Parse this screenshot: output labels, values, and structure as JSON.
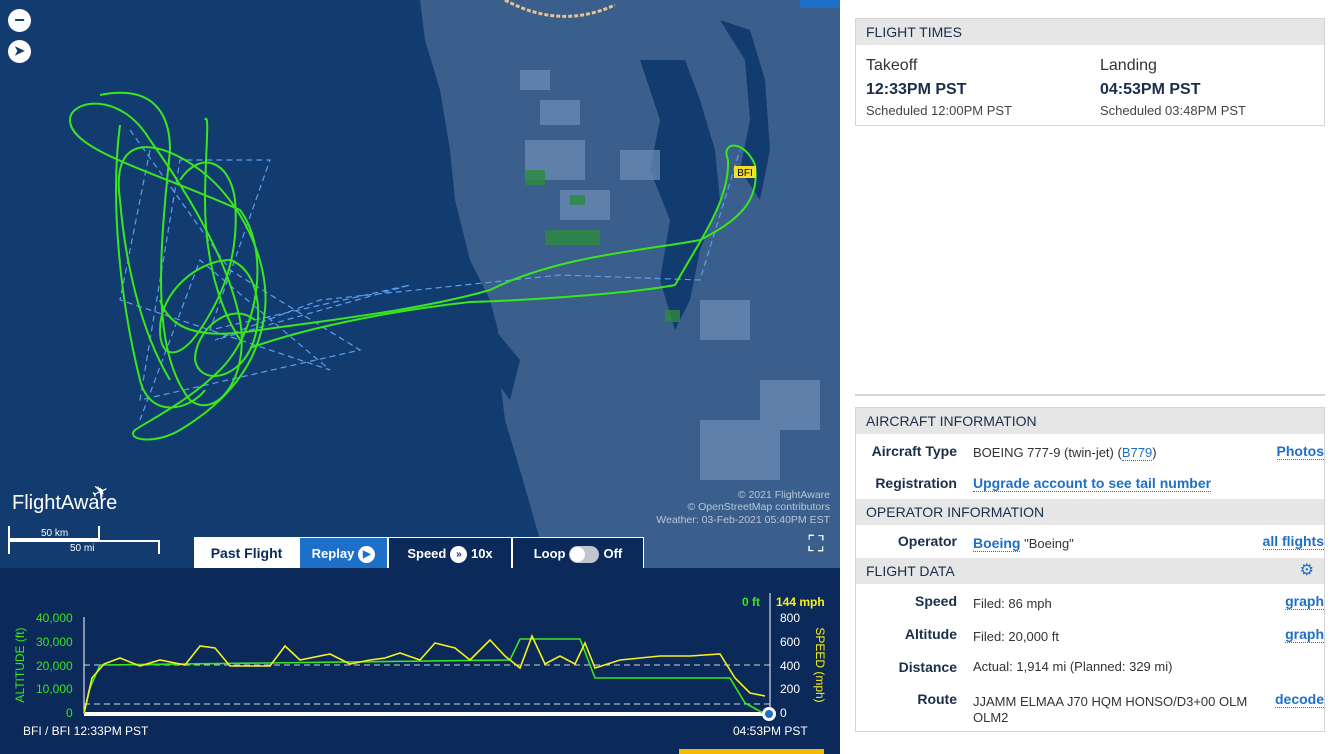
{
  "map": {
    "airport_code": "BFI",
    "logo": "FlightAware",
    "scale": {
      "km": "50 km",
      "mi": "50 mi"
    },
    "attribution": [
      "© 2021 FlightAware",
      "© OpenStreetMap contributors",
      "Weather: 03-Feb-2021 05:40PM EST"
    ],
    "zoom_out_icon": "minus-icon",
    "compass_icon": "compass-icon",
    "expand_icon": "expand-icon",
    "colors": {
      "track": "#39e61e",
      "planned": "#5a9eef",
      "land": "#3a5f8c",
      "water": "#123c70"
    }
  },
  "playback": {
    "past_flight": "Past Flight",
    "replay": "Replay",
    "speed_label": "Speed",
    "speed_value": "10x",
    "loop_label": "Loop",
    "loop_value": "Off"
  },
  "graph": {
    "current_altitude": "0 ft",
    "current_speed": "144 mph",
    "altitude_label": "ALTITUDE (ft)",
    "speed_label": "SPEED (mph)",
    "altitude_ticks": [
      "40,000",
      "30,000",
      "20,000",
      "10,000",
      "0"
    ],
    "speed_ticks": [
      "800",
      "600",
      "400",
      "200",
      "0"
    ],
    "start_label": "BFI / BFI 12:33PM PST",
    "end_label": "04:53PM PST",
    "colors": {
      "altitude": "#39e61e",
      "speed": "#f5f01e"
    }
  },
  "flight_times": {
    "header": "FLIGHT TIMES",
    "takeoff": {
      "label": "Takeoff",
      "time": "12:33PM PST",
      "scheduled": "Scheduled 12:00PM PST"
    },
    "landing": {
      "label": "Landing",
      "time": "04:53PM PST",
      "scheduled": "Scheduled 03:48PM PST"
    }
  },
  "aircraft": {
    "header": "AIRCRAFT INFORMATION",
    "type_label": "Aircraft Type",
    "type_value": "BOEING 777-9 (twin-jet) (",
    "type_code": "B779",
    "type_close": ")",
    "photos": "Photos",
    "registration_label": "Registration",
    "registration_value": "Upgrade account to see tail number"
  },
  "operator": {
    "header": "OPERATOR INFORMATION",
    "label": "Operator",
    "name": "Boeing",
    "quoted": "\"Boeing\"",
    "all_flights": "all flights"
  },
  "flight_data": {
    "header": "FLIGHT DATA",
    "settings_icon": "gear-icon",
    "speed_label": "Speed",
    "speed_value": "Filed: 86 mph",
    "altitude_label": "Altitude",
    "altitude_value": "Filed: 20,000 ft",
    "graph_link": "graph",
    "distance_label": "Distance",
    "distance_value": "Actual: 1,914 mi (Planned: 329 mi)",
    "route_label": "Route",
    "route_value": "JJAMM ELMAA J70 HQM HONSO/D3+00 OLM OLM2",
    "decode": "decode"
  }
}
